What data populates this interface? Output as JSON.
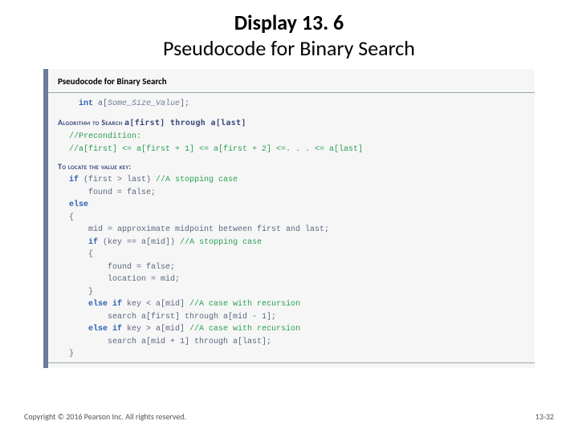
{
  "title": {
    "line1": "Display 13. 6",
    "line2": "Pseudocode for Binary Search"
  },
  "figure": {
    "caption": "Pseudocode for Binary Search",
    "decl": "int a[Some_Size_Value];",
    "algo_header_prefix": "Algorithm to Search ",
    "algo_header_code": "a[first] through a[last]",
    "precond1": "//Precondition:",
    "precond2": "//a[first] <= a[first + 1] <= a[first + 2] <=. . . <= a[last]",
    "locate_header": "To locate the value key:",
    "line_if": "if (first > last) ",
    "line_if_cm": "//A stopping case",
    "line_found_false1": "    found = false;",
    "line_else": "else",
    "line_ob": "{",
    "line_mid": "    mid = approximate midpoint between first and last;",
    "line_ifkey": "    if (key == a[mid]) ",
    "line_ifkey_cm": "//A stopping case",
    "line_ob2": "    {",
    "line_found_false2": "        found = false;",
    "line_loc": "        location = mid;",
    "line_cb2": "    }",
    "line_elif1": "    else if key < a[mid] ",
    "line_elif1_cm": "//A case with recursion",
    "line_search1": "        search a[first] through a[mid - 1];",
    "line_elif2": "    else if key > a[mid] ",
    "line_elif2_cm": "//A case with recursion",
    "line_search2": "        search a[mid + 1] through a[last];",
    "line_cb": "}"
  },
  "footer": {
    "copyright": "Copyright © 2016 Pearson Inc. All rights reserved.",
    "page": "13-32"
  }
}
